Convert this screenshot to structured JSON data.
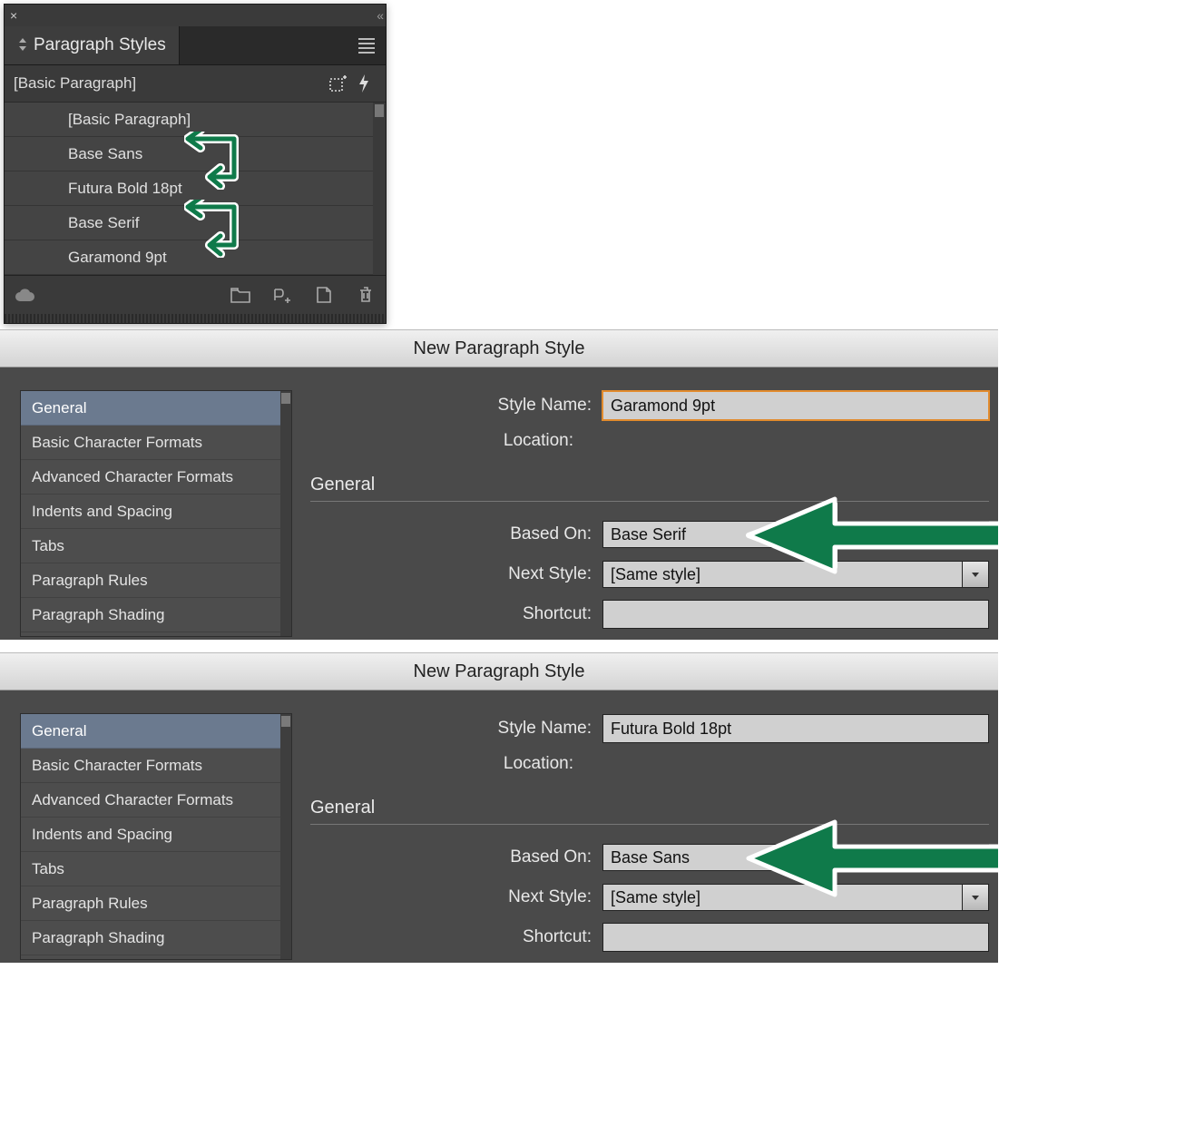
{
  "panel": {
    "title": "Paragraph Styles",
    "selected": "[Basic Paragraph]",
    "styles": [
      "[Basic Paragraph]",
      "Base Sans",
      "Futura Bold 18pt",
      "Base Serif",
      "Garamond 9pt"
    ]
  },
  "dialogs": [
    {
      "title": "New Paragraph Style",
      "style_name_label": "Style Name:",
      "style_name_value": "Garamond 9pt",
      "style_name_highlight": true,
      "location_label": "Location:",
      "section": "General",
      "based_on_label": "Based On:",
      "based_on_value": "Base Serif",
      "next_style_label": "Next Style:",
      "next_style_value": "[Same style]",
      "shortcut_label": "Shortcut:",
      "shortcut_value": "",
      "sidebar": [
        "General",
        "Basic Character Formats",
        "Advanced Character Formats",
        "Indents and Spacing",
        "Tabs",
        "Paragraph Rules",
        "Paragraph Shading"
      ]
    },
    {
      "title": "New Paragraph Style",
      "style_name_label": "Style Name:",
      "style_name_value": "Futura Bold 18pt",
      "style_name_highlight": false,
      "location_label": "Location:",
      "section": "General",
      "based_on_label": "Based On:",
      "based_on_value": "Base Sans",
      "next_style_label": "Next Style:",
      "next_style_value": "[Same style]",
      "shortcut_label": "Shortcut:",
      "shortcut_value": "",
      "sidebar": [
        "General",
        "Basic Character Formats",
        "Advanced Character Formats",
        "Indents and Spacing",
        "Tabs",
        "Paragraph Rules",
        "Paragraph Shading"
      ]
    }
  ],
  "arrow_color": "#0f7a4a"
}
